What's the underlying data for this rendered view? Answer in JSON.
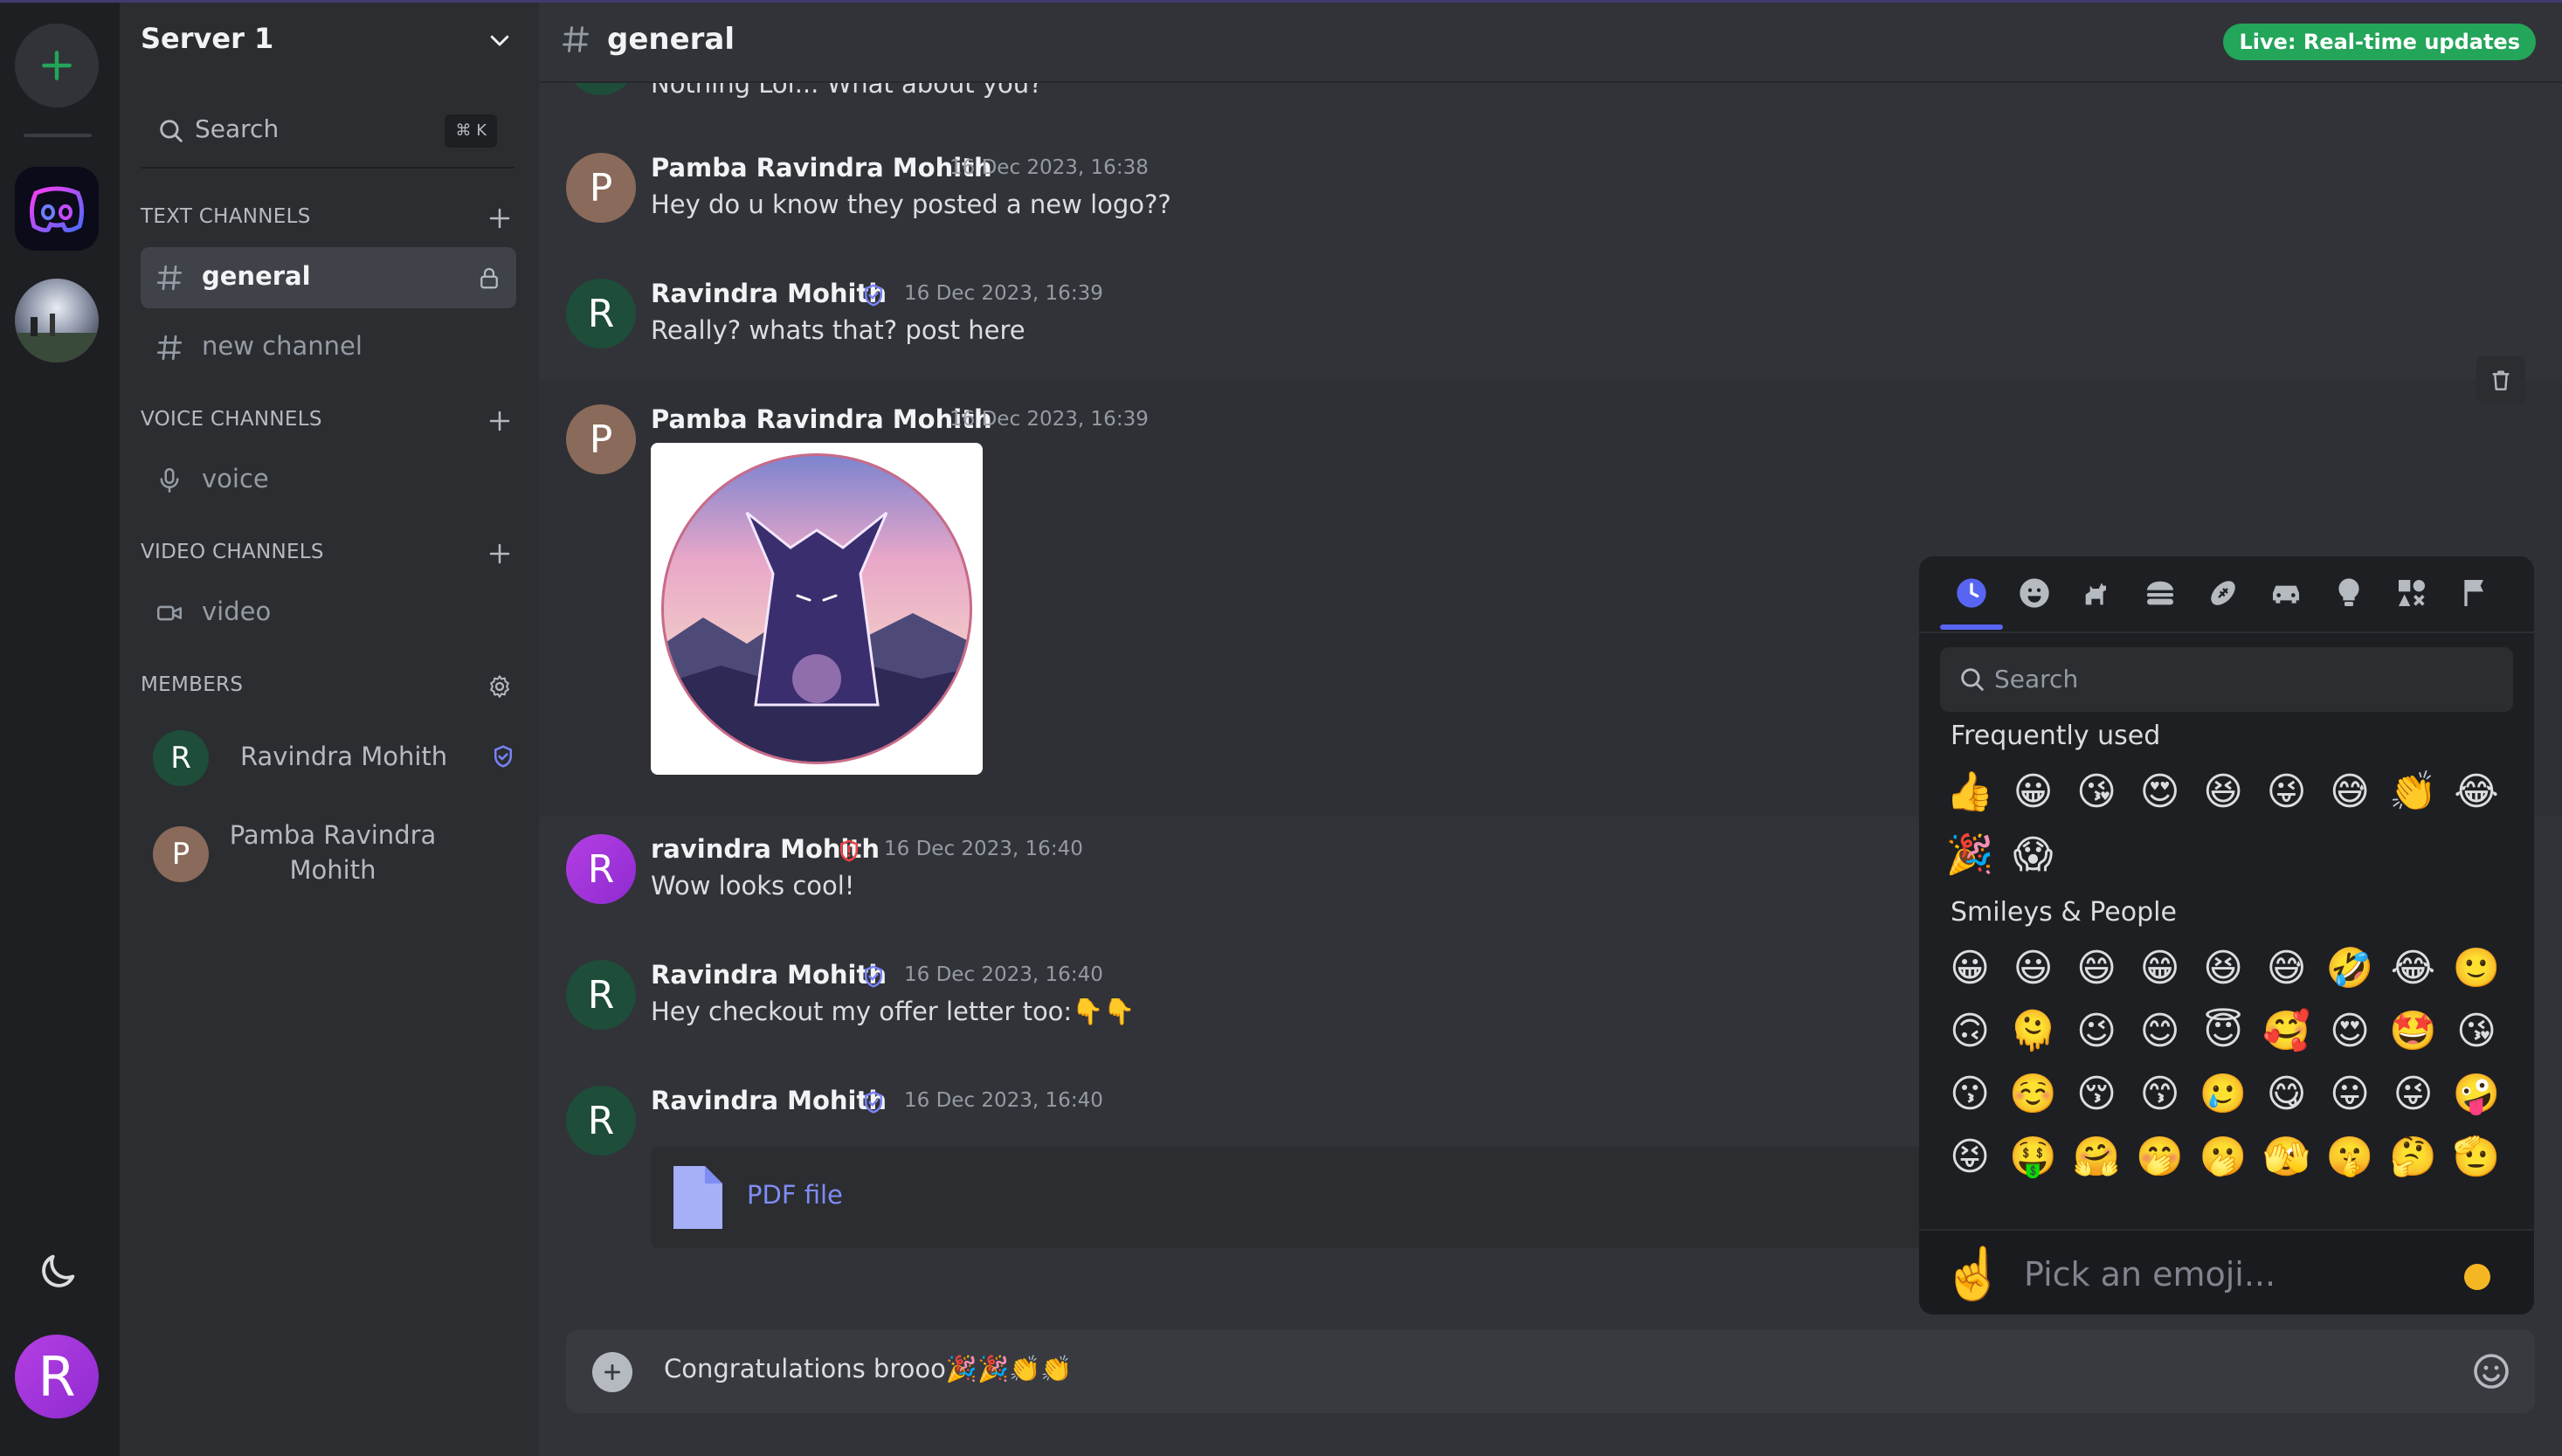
{
  "server": {
    "name": "Server 1"
  },
  "search": {
    "label": "Search",
    "shortcut": "⌘ K"
  },
  "sections": {
    "text": "TEXT CHANNELS",
    "voice": "VOICE CHANNELS",
    "video": "VIDEO CHANNELS",
    "members": "MEMBERS"
  },
  "channels": {
    "text": [
      {
        "name": "general",
        "active": true
      },
      {
        "name": "new channel",
        "active": false
      }
    ],
    "voice": [
      {
        "name": "voice"
      }
    ],
    "video": [
      {
        "name": "video"
      }
    ]
  },
  "members": [
    {
      "initial": "R",
      "name": "Ravindra Mohith",
      "color": "#1e4d3a"
    },
    {
      "initial": "P",
      "name_line1": "Pamba Ravindra",
      "name_line2": "Mohith",
      "color": "#8a6a5a"
    }
  ],
  "header": {
    "channel": "general",
    "live_badge": "Live: Real-time updates"
  },
  "messages": [
    {
      "text": "Nothing Lol... What about you?"
    },
    {
      "initial": "P",
      "author": "Pamba Ravindra Mohith",
      "time": "16 Dec 2023, 16:38",
      "text": "Hey do u know they posted a new logo??"
    },
    {
      "initial": "R",
      "author": "Ravindra Mohith",
      "time": "16 Dec 2023, 16:39",
      "text": "Really? whats that? post here"
    },
    {
      "initial": "P",
      "author": "Pamba Ravindra Mohith",
      "time": "16 Dec 2023, 16:39"
    },
    {
      "initial": "R",
      "author": "ravindra Mohith",
      "time": "16 Dec 2023, 16:40",
      "text": "Wow looks cool!"
    },
    {
      "initial": "R",
      "author": "Ravindra Mohith",
      "time": "16 Dec 2023, 16:40",
      "text": "Hey checkout my offer letter too:👇👇"
    },
    {
      "initial": "R",
      "author": "Ravindra Mohith",
      "time": "16 Dec 2023, 16:40",
      "attachment": "PDF file"
    }
  ],
  "composer": {
    "value": "Congratulations brooo🎉🎉👏👏"
  },
  "emoji_picker": {
    "search_placeholder": "Search",
    "categories": [
      "clock-icon",
      "smiley-icon",
      "dog-icon",
      "burger-icon",
      "football-icon",
      "car-icon",
      "lightbulb-icon",
      "symbols-icon",
      "flag-icon"
    ],
    "frequently_used_title": "Frequently used",
    "frequently_used": [
      "👍",
      "😀",
      "😘",
      "😍",
      "😆",
      "😜",
      "😅",
      "👏",
      "😂",
      "🎉",
      "😱"
    ],
    "smileys_title": "Smileys & People",
    "smileys": [
      "😀",
      "😃",
      "😄",
      "😁",
      "😆",
      "😅",
      "🤣",
      "😂",
      "🙂",
      "🙃",
      "🫠",
      "😉",
      "😊",
      "😇",
      "🥰",
      "😍",
      "🤩",
      "😘",
      "😗",
      "☺️",
      "😚",
      "😙",
      "🥲",
      "😋",
      "😛",
      "😜",
      "🤪",
      "😝",
      "🤑",
      "🤗",
      "🤭",
      "🫢",
      "🫣",
      "🤫",
      "🤔",
      "🫡"
    ],
    "footer_emoji": "☝️",
    "footer_label": "Pick an emoji..."
  },
  "user": {
    "initial": "R"
  },
  "colors": {
    "accent": "#5865f2",
    "live": "#23a55a",
    "shield": "#7983f5",
    "shield_red": "#ed4245"
  }
}
